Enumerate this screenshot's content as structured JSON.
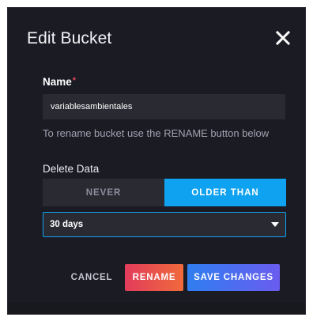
{
  "dialog": {
    "title": "Edit Bucket",
    "close_icon": "close-icon"
  },
  "name_field": {
    "label": "Name",
    "required_marker": "*",
    "value": "variablesambientales"
  },
  "hint": "To rename bucket use the RENAME button below",
  "delete_data": {
    "label": "Delete Data",
    "options": [
      "NEVER",
      "OLDER THAN"
    ],
    "selected": "OLDER THAN"
  },
  "retention_select": {
    "value": "30 days",
    "caret_icon": "caret-down-icon"
  },
  "actions": {
    "cancel_label": "CANCEL",
    "rename_label": "RENAME",
    "save_label": "SAVE CHANGES"
  },
  "colors": {
    "modal_bg": "#1b1b24",
    "input_bg": "#2a2a33",
    "accent_blue": "#0fa2f0",
    "rename_gradient": [
      "#e23c5b",
      "#f06a3c"
    ],
    "save_gradient": [
      "#2f7ef0",
      "#6a5cf0"
    ],
    "required_red": "#e0485a"
  }
}
